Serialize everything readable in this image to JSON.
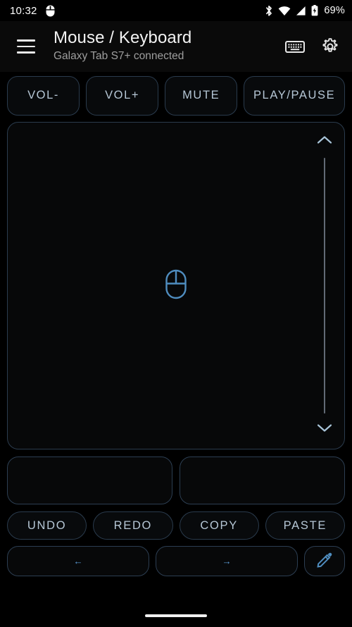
{
  "status_bar": {
    "clock": "10:32",
    "battery_percent": "69%",
    "icons": {
      "notification": "mouse-icon",
      "bluetooth": "bluetooth-icon",
      "wifi": "wifi-icon",
      "cellular": "cellular-signal-icon",
      "battery": "battery-icon"
    }
  },
  "app_bar": {
    "menu_icon": "hamburger-menu-icon",
    "title": "Mouse / Keyboard",
    "subtitle": "Galaxy Tab S7+ connected",
    "keyboard_icon": "keyboard-icon",
    "settings_icon": "gear-icon"
  },
  "media_buttons": [
    {
      "label": "VOL-",
      "name": "volume-down-button"
    },
    {
      "label": "VOL+",
      "name": "volume-up-button"
    },
    {
      "label": "MUTE",
      "name": "mute-button"
    },
    {
      "label": "PLAY/\nPAUSE",
      "label_line1": "PLAY/",
      "label_line2": "PAUSE",
      "name": "play-pause-button"
    }
  ],
  "touchpad": {
    "center_icon": "mouse-icon",
    "scroll": {
      "up_icon": "chevron-up-icon",
      "down_icon": "chevron-down-icon"
    }
  },
  "click_buttons": [
    {
      "label": "",
      "name": "left-click-button"
    },
    {
      "label": "",
      "name": "right-click-button"
    }
  ],
  "edit_buttons": [
    {
      "label": "UNDO",
      "name": "undo-button"
    },
    {
      "label": "REDO",
      "name": "redo-button"
    },
    {
      "label": "COPY",
      "name": "copy-button"
    },
    {
      "label": "PASTE",
      "name": "paste-button"
    }
  ],
  "arrow_buttons": {
    "left": {
      "glyph": "←",
      "name": "arrow-left-button"
    },
    "right": {
      "glyph": "→",
      "name": "arrow-right-button"
    },
    "pencil": {
      "icon": "pencil-icon",
      "name": "edit-text-button"
    }
  },
  "colors": {
    "background": "#000000",
    "surface": "#0a0a0a",
    "accent_blue": "#5b9bd5",
    "border_blue": "#2a3b4d",
    "text_primary": "#f2f2f2",
    "text_secondary": "#9e9e9e",
    "button_text": "#b6c7d6"
  }
}
